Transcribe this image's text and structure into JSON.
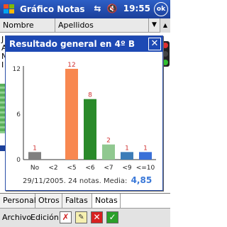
{
  "titlebar": {
    "app_title": "Gráfico Notas",
    "time": "19:55",
    "ok_label": "ok"
  },
  "list": {
    "columns": [
      "Nombre",
      "Apellidos"
    ],
    "row_stubs": [
      "J",
      "A",
      "N",
      "I"
    ]
  },
  "popup": {
    "title": "Resultado general en 4º B",
    "close_label": "✕",
    "footer_text": "29/11/2005. 24 notas. Media:",
    "media": "4,85"
  },
  "chart_data": {
    "type": "bar",
    "categories": [
      "No",
      "<2",
      "<5",
      "<6",
      "<7",
      "<9",
      "<=10"
    ],
    "values": [
      1,
      0,
      12,
      8,
      2,
      1,
      1
    ],
    "colors": [
      "#808080",
      "#808080",
      "#f88850",
      "#2a8a2a",
      "#90c890",
      "#3c7cb8",
      "#3a70d8"
    ],
    "value_labels": [
      "1",
      "",
      "12",
      "8",
      "2",
      "1",
      "1"
    ],
    "yticks": [
      "12",
      "6",
      "0"
    ],
    "ylim": [
      0,
      12
    ]
  },
  "tabs": [
    "Personal",
    "Otros",
    "Faltas",
    "Notas"
  ],
  "active_tab": "Notas",
  "menu": {
    "archivo": "Archivo",
    "edicion": "Edición"
  }
}
